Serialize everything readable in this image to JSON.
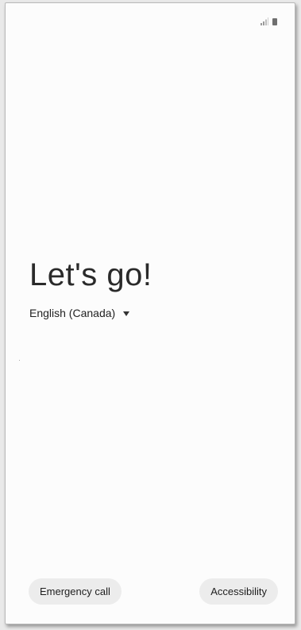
{
  "status_bar": {
    "signal_icon": "signal-icon",
    "battery_icon": "battery-icon"
  },
  "welcome": {
    "title": "Let's go!",
    "language": "English (Canada)",
    "dropdown_icon": "dropdown-triangle-icon"
  },
  "footer": {
    "emergency_call_label": "Emergency call",
    "accessibility_label": "Accessibility"
  },
  "colors": {
    "background": "#fcfcfc",
    "button_bg": "#ececec",
    "text": "#2a2a2a"
  }
}
